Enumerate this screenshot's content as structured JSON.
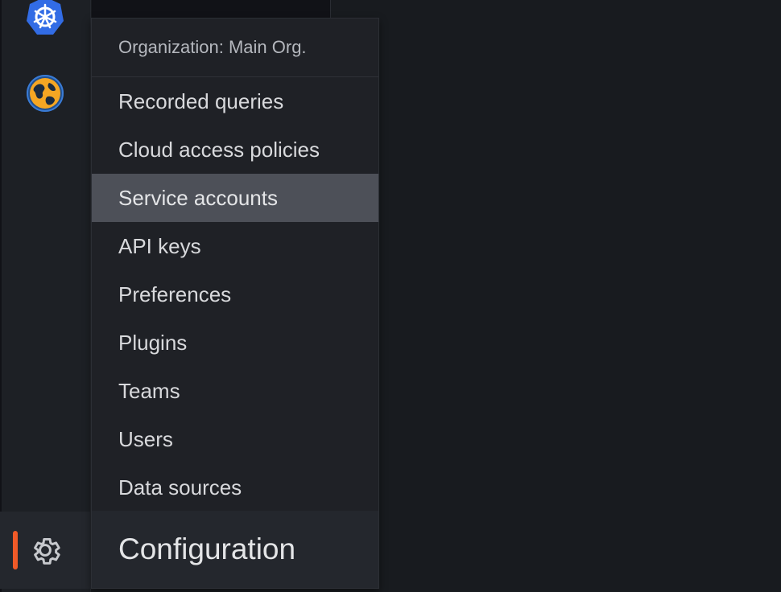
{
  "sidemenu": {
    "icons": {
      "top": "kubernetes-icon",
      "second": "globe-icon",
      "active": "gear-icon"
    },
    "active_indicator_color": "#f05a28"
  },
  "dropdown": {
    "org_label": "Organization: Main Org.",
    "items": [
      {
        "label": "Recorded queries"
      },
      {
        "label": "Cloud access policies"
      },
      {
        "label": "Service accounts"
      },
      {
        "label": "API keys"
      },
      {
        "label": "Preferences"
      },
      {
        "label": "Plugins"
      },
      {
        "label": "Teams"
      },
      {
        "label": "Users"
      },
      {
        "label": "Data sources"
      }
    ],
    "highlighted_item": "Service accounts",
    "section_title": "Configuration"
  }
}
